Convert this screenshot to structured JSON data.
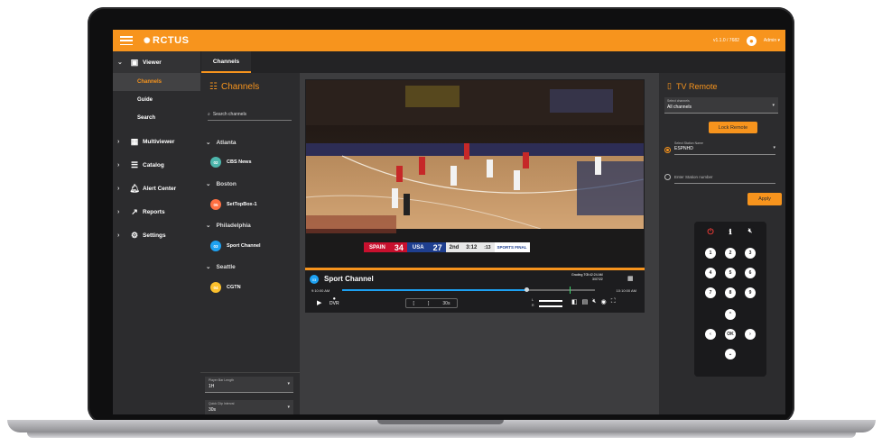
{
  "app": {
    "logo": "RCTUS",
    "logo_mark": "✺",
    "version": "v1.1.0 / 7682",
    "user": "Admin ▾"
  },
  "colors": {
    "accent": "#f7941d",
    "sidebar": "#2c2c2e",
    "live_blue": "#1da1f2"
  },
  "sidebar": {
    "viewer": "Viewer",
    "viewer_items": [
      "Channels",
      "Guide",
      "Search"
    ],
    "groups": [
      "Multiviewer",
      "Catalog",
      "Alert Center",
      "Reports",
      "Settings"
    ]
  },
  "tabs": [
    "Channels"
  ],
  "channels": {
    "title": "Channels",
    "search_placeholder": "Search channels",
    "cities": [
      {
        "name": "Atlanta",
        "channels": [
          {
            "num": "02",
            "name": "CBS News",
            "color": "#4db6ac"
          }
        ]
      },
      {
        "name": "Boston",
        "channels": [
          {
            "num": "05",
            "name": "SetTopBox-1",
            "color": "#ff7043"
          }
        ]
      },
      {
        "name": "Philadelphia",
        "channels": [
          {
            "num": "03",
            "name": "Sport Channel",
            "color": "#1da1f2"
          }
        ]
      },
      {
        "name": "Seattle",
        "channels": [
          {
            "num": "04",
            "name": "CGTN",
            "color": "#fbc02d"
          }
        ]
      }
    ],
    "player_bar_label": "Player Bar Length",
    "player_bar_value": "1H",
    "quick_clip_label": "Quick Clip Interval",
    "quick_clip_value": "30s"
  },
  "player": {
    "channel_num": "03",
    "channel_name": "Sport Channel",
    "time_start": "9:10:00 AM",
    "time_end": "10:10:00 AM",
    "progress": 0.73,
    "live_mark": 0.9,
    "info_label": "Grading\nTC",
    "info_time": "9:42:24 AM",
    "info_date": "3/07/22",
    "info_frame": "9:42:24 AM",
    "clip_label": "30s",
    "dvr_label": "DVR",
    "vol_l": "L",
    "vol_r": "R",
    "hud": {
      "team1": "SPAIN",
      "score1": "34",
      "team2": "USA",
      "score2": "27",
      "quarter": "2nd",
      "clock": "3:12",
      "shot": ":13",
      "brand": "SPORTS FINAL"
    }
  },
  "remote": {
    "title": "TV Remote",
    "network_label": "Select channels",
    "network_value": "All channels",
    "lock_label": "Lock Remote",
    "station_label": "Select Station Name",
    "station_value": "ESPNHD",
    "station_num_placeholder": "Enter Station number",
    "apply_label": "Apply",
    "keys": [
      "1",
      "2",
      "3",
      "4",
      "5",
      "6",
      "7",
      "8",
      "9"
    ],
    "ok": "OK"
  }
}
